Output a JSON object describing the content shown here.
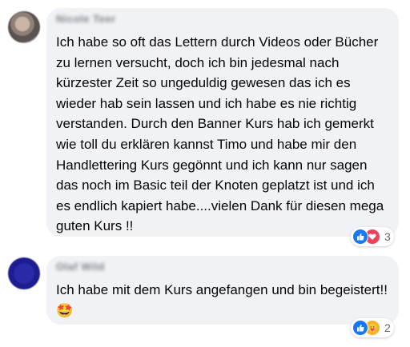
{
  "comments": [
    {
      "author": "Nicole Teer",
      "text": "Ich habe so oft das Lettern durch Videos oder Bücher zu lernen versucht, doch ich bin jedesmal nach kürzester Zeit so ungeduldig gewesen das ich es wieder hab sein lassen und ich habe es nie richtig verstanden. Durch den Banner Kurs hab ich gemerkt wie toll du erklären kannst Timo und habe mir den Handlettering Kurs gegönnt und ich kann nur sagen das noch im Basic teil der Knoten geplatzt ist und ich es endlich kapiert habe....vielen Dank für diesen mega guten Kurs !!",
      "reactions": {
        "icons": [
          "like-icon",
          "love-icon"
        ],
        "count": "3"
      }
    },
    {
      "author": "Olaf Wild",
      "text": "Ich habe mit dem Kurs angefangen und bin begeistert!!",
      "emoji": "🤩",
      "reactions": {
        "icons": [
          "like-icon",
          "care-icon"
        ],
        "count": "2"
      }
    }
  ],
  "colors": {
    "bubble": "#f0f2f5",
    "like": "#1877f2",
    "love": "#f33e58",
    "care": "#f7b125",
    "muted_text": "#65676b"
  }
}
